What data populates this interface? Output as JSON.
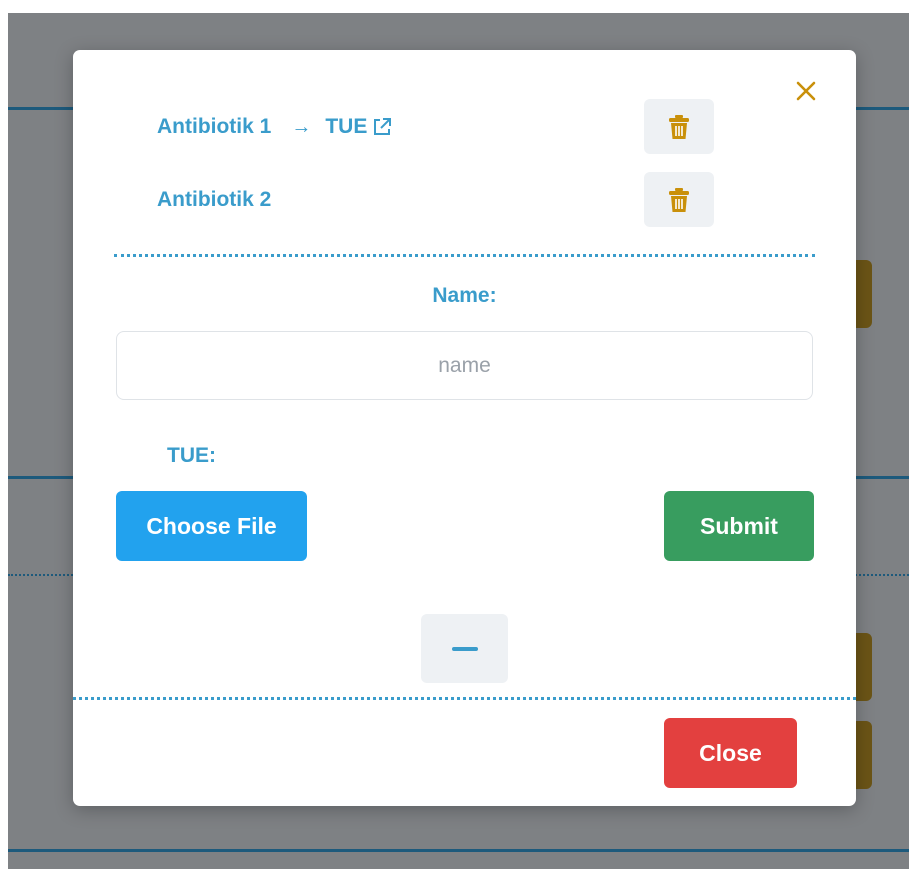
{
  "colors": {
    "accent": "#3a9ccb",
    "choose_file": "#22a2ee",
    "submit": "#389d5f",
    "close": "#e3403f",
    "trash": "#c9900a",
    "backdrop": "#7e8184"
  },
  "modal": {
    "close_icon": "close-x-icon",
    "items": [
      {
        "label": "Antibiotik 1",
        "arrow": "→",
        "link": "TUE",
        "link_icon": "external-link-icon",
        "delete_icon": "trash-icon"
      },
      {
        "label": "Antibiotik 2",
        "delete_icon": "trash-icon"
      }
    ],
    "form": {
      "name_label": "Name:",
      "name_value": "",
      "name_placeholder": "name",
      "tue_label": "TUE:",
      "choose_file_label": "Choose File",
      "submit_label": "Submit"
    },
    "collapse_icon": "minus-icon",
    "footer": {
      "close_label": "Close"
    }
  }
}
